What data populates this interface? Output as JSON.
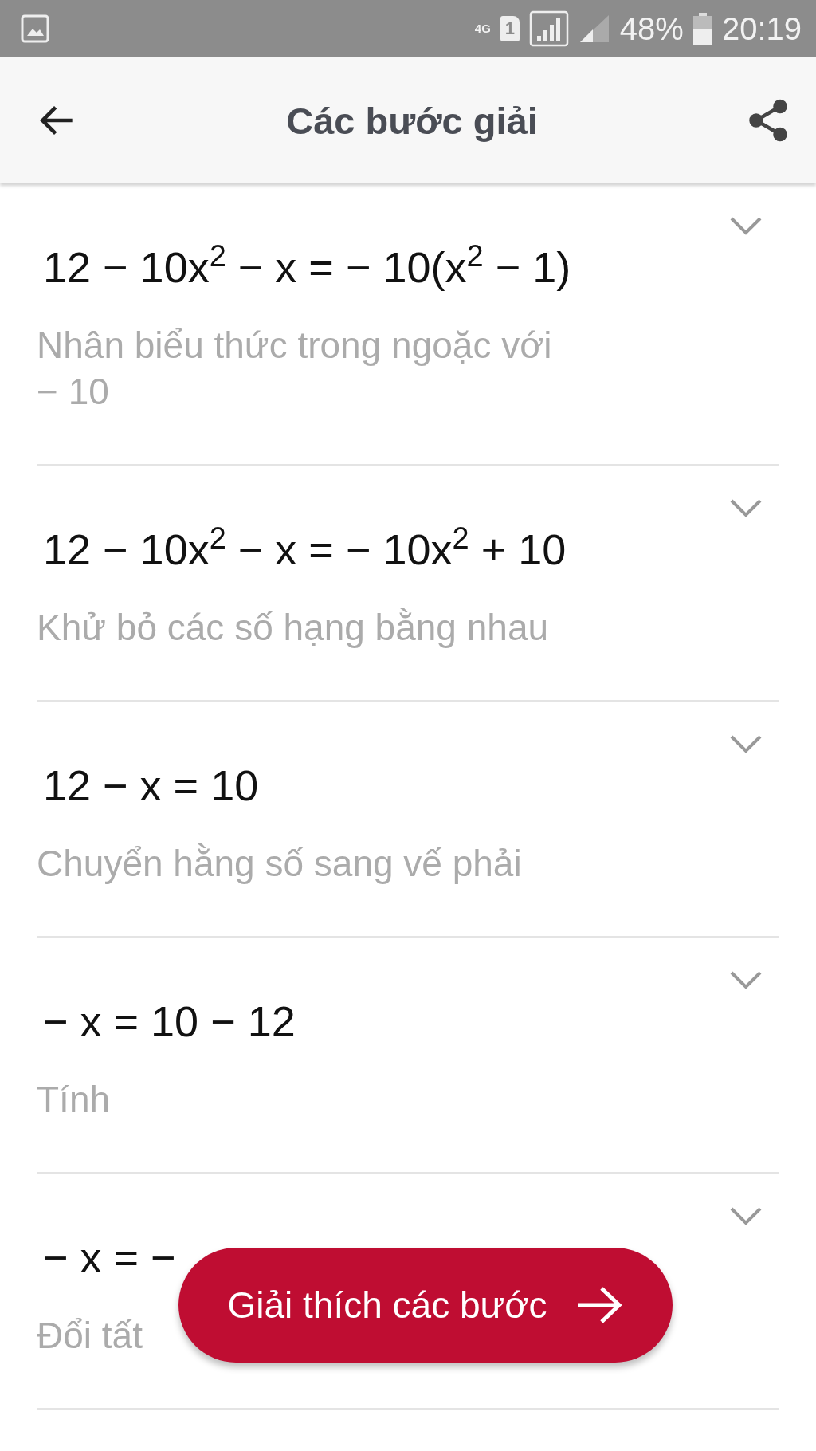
{
  "status_bar": {
    "network": "4G",
    "sim": "1",
    "battery": "48%",
    "time": "20:19"
  },
  "header": {
    "title": "Các bước giải"
  },
  "steps": [
    {
      "equation": "12 − 10x$^{2}$ − x = − 10(x$^{2}$ − 1)",
      "explanation": "Nhân biểu thức trong ngoặc với\n− 10",
      "expanded": false
    },
    {
      "equation": "12 − 10x$^{2}$ − x = − 10x$^{2}$ + 10",
      "explanation": "Khử bỏ các số hạng bằng nhau",
      "expanded": false
    },
    {
      "equation": "12 − x = 10",
      "explanation": "Chuyển hằng số sang vế phải",
      "expanded": false
    },
    {
      "equation": "− x = 10 − 12",
      "explanation": "Tính",
      "expanded": false
    },
    {
      "equation": "− x = −",
      "explanation": "Đổi tất",
      "expanded": false
    }
  ],
  "action_button": {
    "label": "Giải thích các bước"
  }
}
